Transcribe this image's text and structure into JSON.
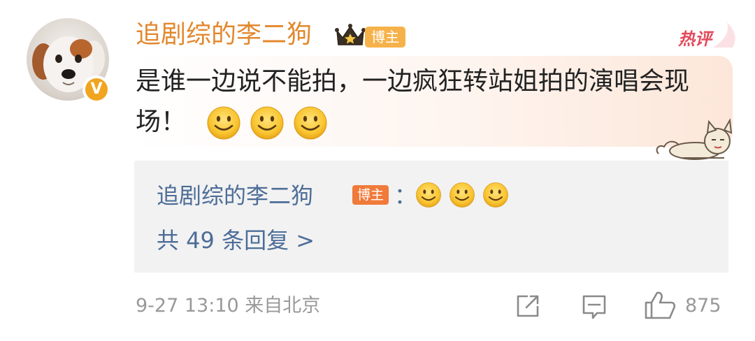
{
  "post": {
    "username": "追剧综的李二狗",
    "user_tag": "博主",
    "hot_label": "热评",
    "verified_badge": "V",
    "comment_text": "是谁一边说不能拍，一边疯狂转站姐拍的演唱会现场！",
    "comment_emojis": [
      "smile-icon",
      "smile-icon",
      "smile-icon"
    ],
    "timestamp": "9-27 13:10",
    "location": "来自北京",
    "meta_text": "9-27 13:10 来自北京",
    "like_count": "875"
  },
  "reply": {
    "username": "追剧综的李二狗",
    "user_tag": "博主",
    "colon": "：",
    "emojis": [
      "smile-icon",
      "smile-icon",
      "smile-icon"
    ],
    "count_text": "共 49 条回复 >"
  },
  "colors": {
    "username": "#e2882e",
    "link_blue": "#4d6d98",
    "tag_orange": "#f07a3a",
    "hot_red": "#e24a5c",
    "meta_gray": "#999999"
  }
}
